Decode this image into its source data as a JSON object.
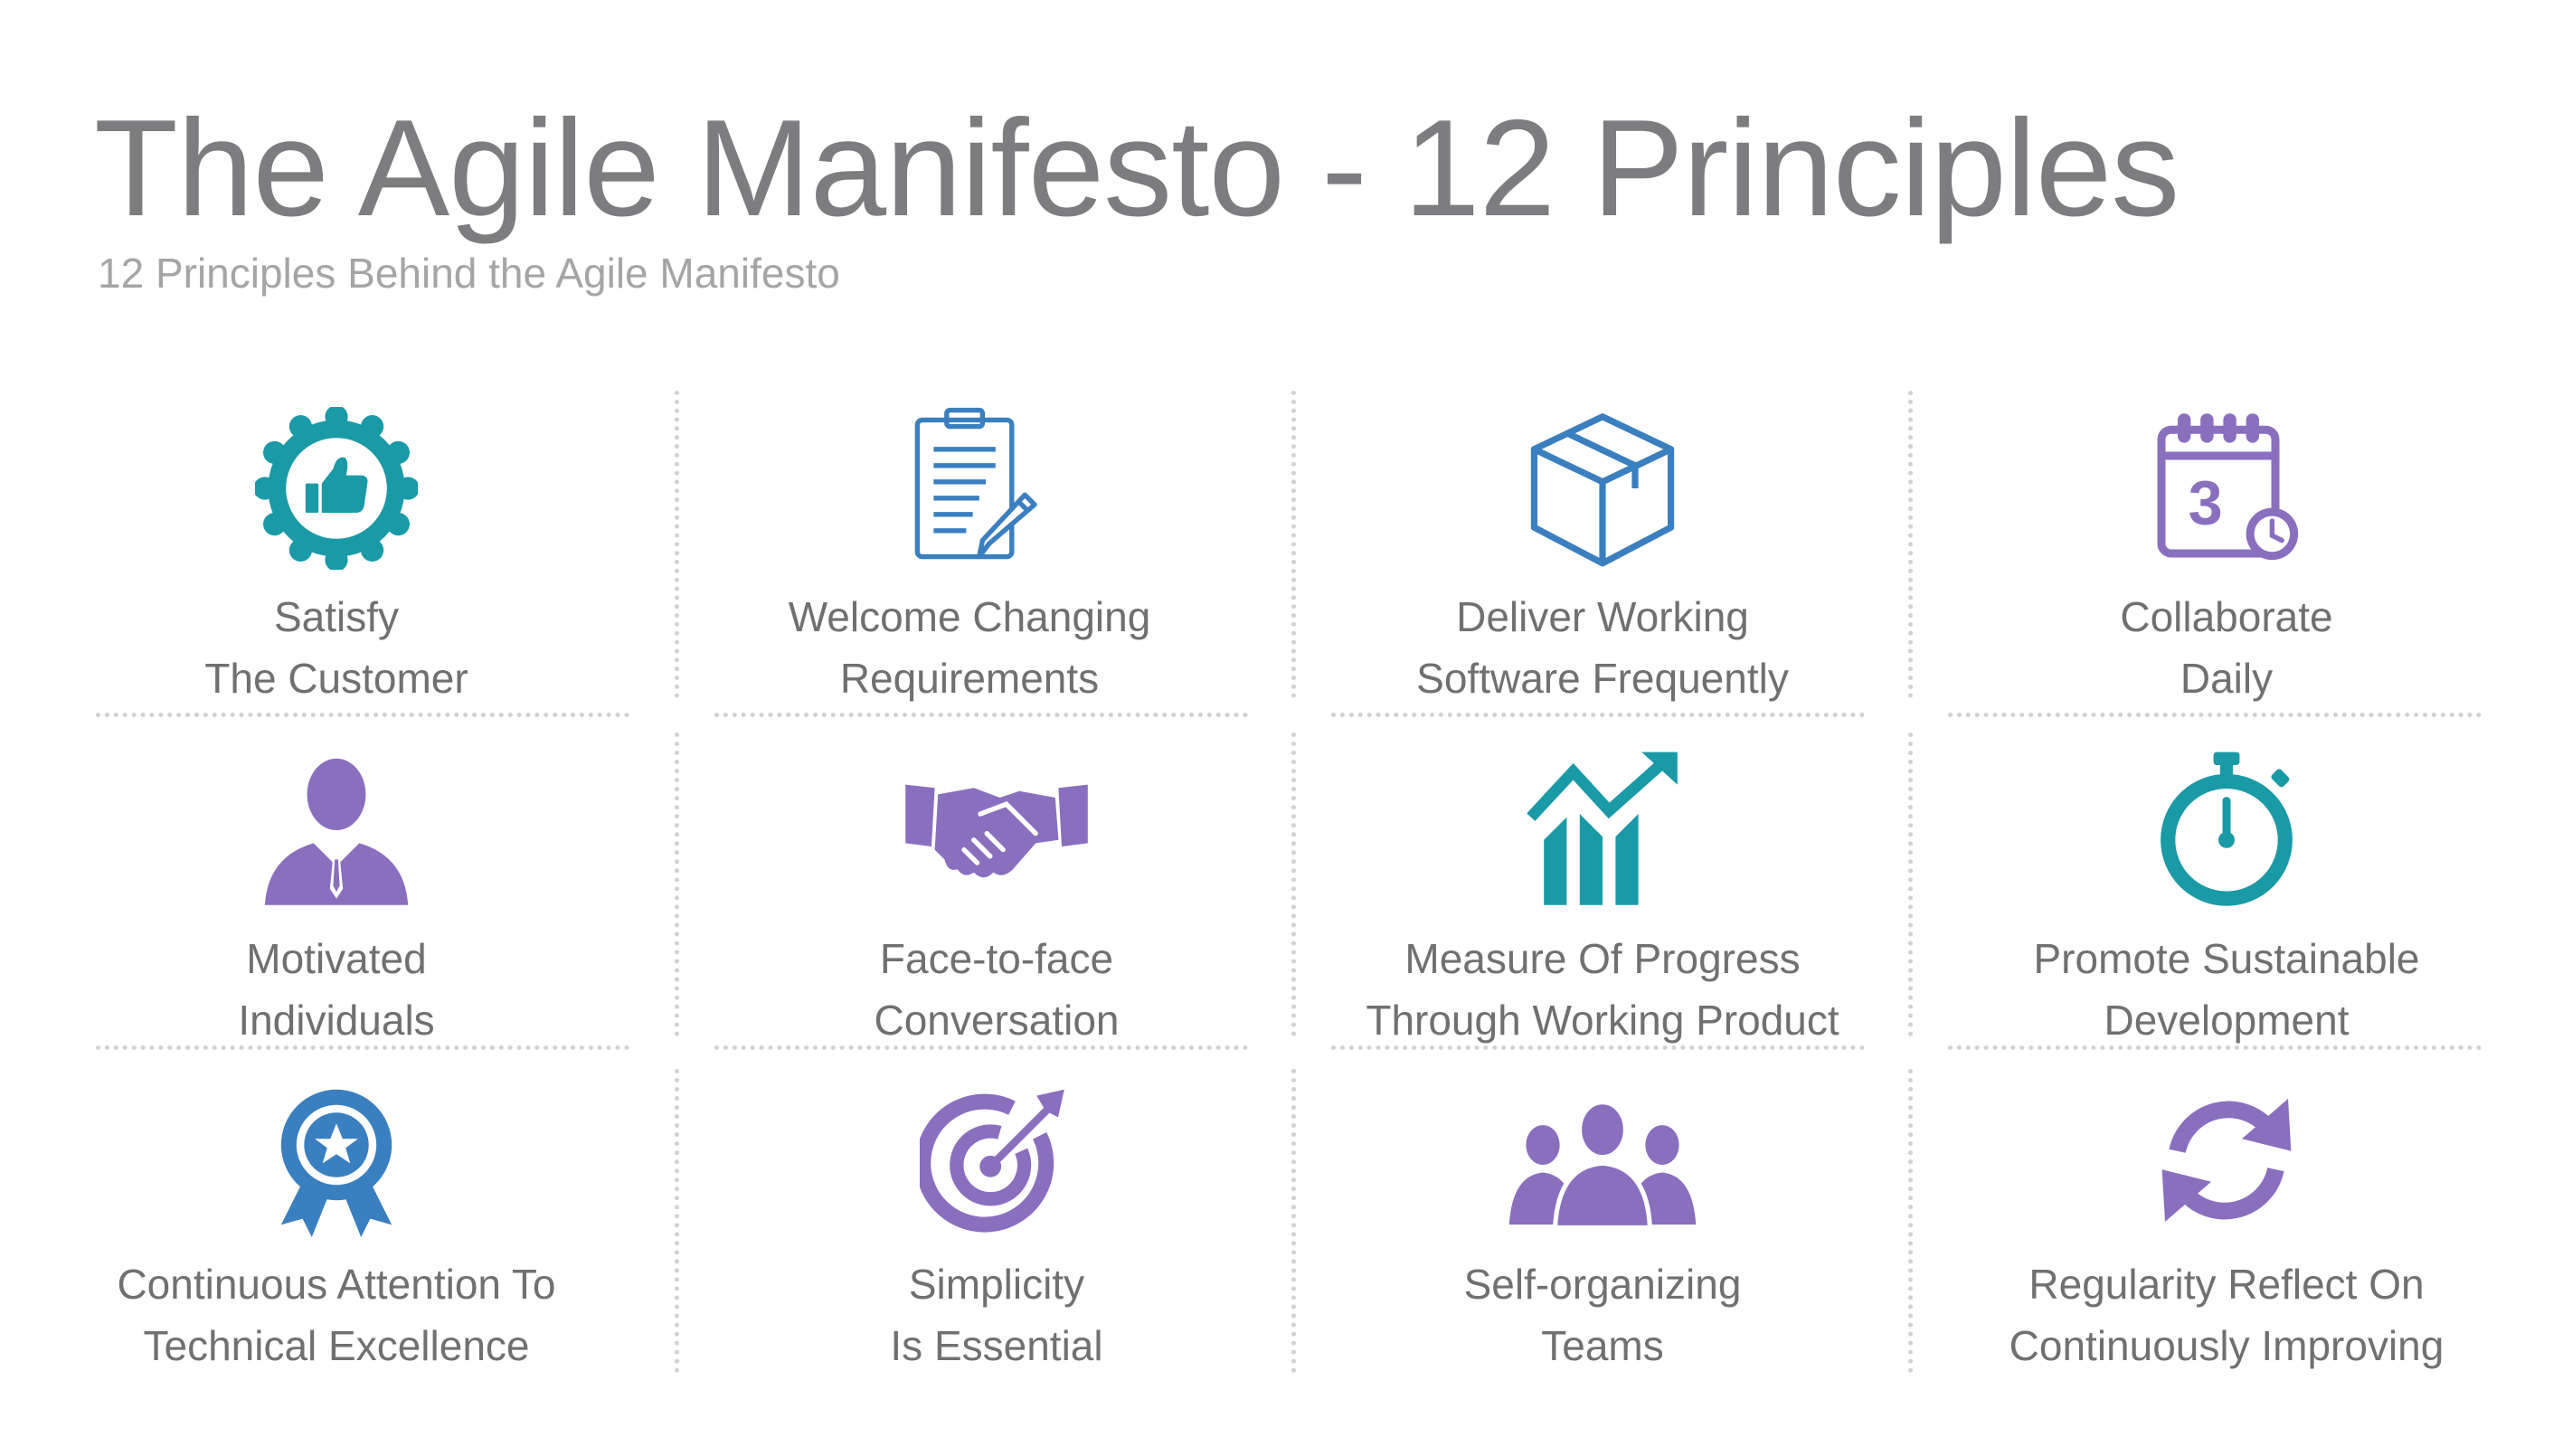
{
  "header": {
    "title": "The Agile Manifesto - 12 Principles",
    "subtitle": "12 Principles Behind the Agile Manifesto"
  },
  "colors": {
    "title": "#7d7d80",
    "teal": "#1a9aa6",
    "blue": "#3a7fbf",
    "purple": "#8a6fbf",
    "divider": "#d2d2d2"
  },
  "principles": [
    {
      "line1": "Satisfy",
      "line2": "The Customer",
      "icon": "thumbs-up-badge-icon"
    },
    {
      "line1": "Welcome Changing",
      "line2": "Requirements",
      "icon": "clipboard-pencil-icon"
    },
    {
      "line1": "Deliver Working",
      "line2": "Software Frequently",
      "icon": "box-icon"
    },
    {
      "line1": "Collaborate",
      "line2": "Daily",
      "icon": "calendar-clock-icon"
    },
    {
      "line1": "Motivated",
      "line2": "Individuals",
      "icon": "businessman-icon"
    },
    {
      "line1": "Face-to-face",
      "line2": "Conversation",
      "icon": "handshake-icon"
    },
    {
      "line1": "Measure Of Progress",
      "line2": "Through Working Product",
      "icon": "growth-chart-icon"
    },
    {
      "line1": "Promote Sustainable",
      "line2": "Development",
      "icon": "stopwatch-icon"
    },
    {
      "line1": "Continuous Attention To",
      "line2": "Technical Excellence",
      "icon": "award-ribbon-icon"
    },
    {
      "line1": "Simplicity",
      "line2": "Is Essential",
      "icon": "target-arrow-icon"
    },
    {
      "line1": "Self-organizing",
      "line2": "Teams",
      "icon": "team-icon"
    },
    {
      "line1": "Regularity Reflect On",
      "line2": "Continuously Improving",
      "icon": "refresh-cycle-icon"
    }
  ]
}
